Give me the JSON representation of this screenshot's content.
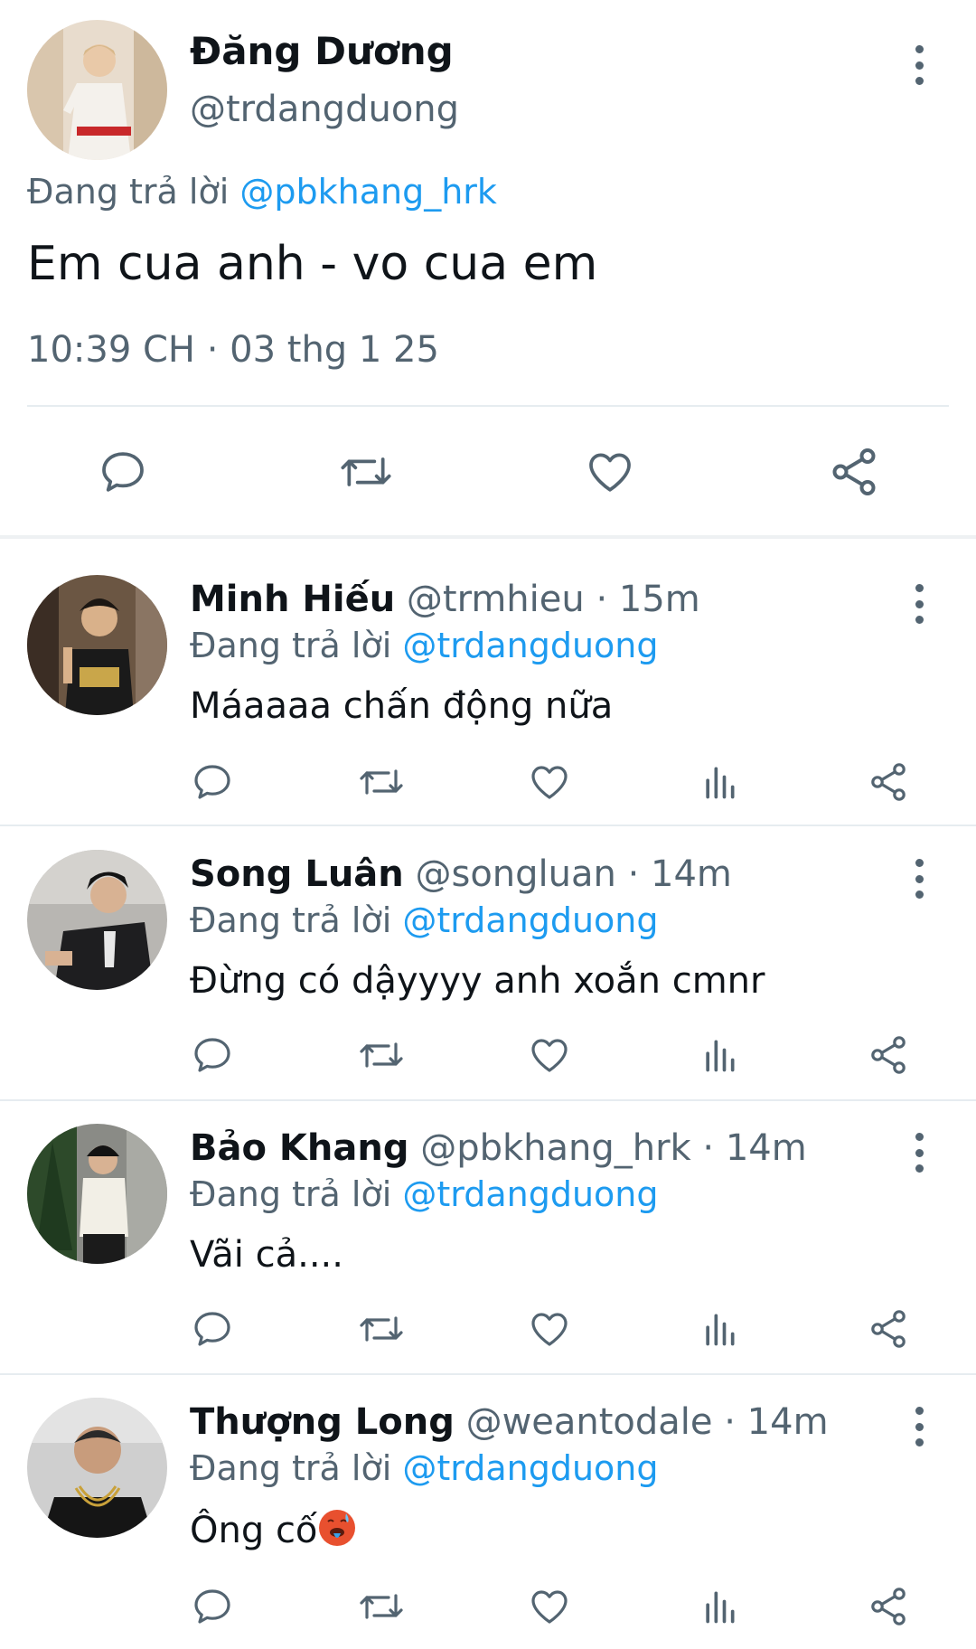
{
  "main_tweet": {
    "name": "Đăng Dương",
    "handle": "@trdangduong",
    "reply_prefix": "Đang trả lời",
    "reply_to": "@pbkhang_hrk",
    "text": "Em cua anh - vo cua em",
    "timestamp": "10:39 CH · 03 thg 1 25",
    "actions": [
      "reply-icon",
      "retweet-icon",
      "like-icon",
      "share-icon"
    ]
  },
  "replies": [
    {
      "name": "Minh Hiếu",
      "handle": "@trmhieu",
      "time": "· 15m",
      "reply_prefix": "Đang trả lời",
      "reply_to": "@trdangduong",
      "text": "Máaaaa chấn động nữa"
    },
    {
      "name": "Song Luân",
      "handle": "@songluan",
      "time": "· 14m",
      "reply_prefix": "Đang trả lời",
      "reply_to": "@trdangduong",
      "text": "Đừng có dậyyyy anh xoắn cmnr"
    },
    {
      "name": "Bảo Khang",
      "handle": "@pbkhang_hrk",
      "time": "· 14m",
      "reply_prefix": "Đang trả lời",
      "reply_to": "@trdangduong",
      "text": "Vãi cả...."
    },
    {
      "name": "Thượng Long",
      "handle": "@weantodale",
      "time": "· 14m",
      "reply_prefix": "Đang trả lời",
      "reply_to": "@trdangduong",
      "text": "Ông cố",
      "emoji": "hot-face-emoji"
    }
  ],
  "reply_actions": [
    "reply-icon",
    "retweet-icon",
    "like-icon",
    "views-icon",
    "share-icon"
  ],
  "colors": {
    "text": "#0f1419",
    "secondary": "#536471",
    "mention": "#1d9bf0",
    "divider": "#e6ecf0"
  }
}
